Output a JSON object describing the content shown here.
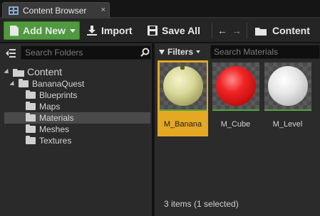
{
  "tab": {
    "title": "Content Browser",
    "close": "×"
  },
  "toolbar": {
    "add_new": "Add New",
    "import": "Import",
    "save_all": "Save All",
    "back": "←",
    "forward": "→",
    "path": "Content"
  },
  "sources": {
    "search_placeholder": "Search Folders",
    "tree": [
      {
        "label": "Content",
        "level": 0,
        "expanded": true,
        "selected": false
      },
      {
        "label": "BananaQuest",
        "level": 1,
        "expanded": true,
        "selected": false
      },
      {
        "label": "Blueprints",
        "level": 2,
        "selected": false
      },
      {
        "label": "Maps",
        "level": 2,
        "selected": false
      },
      {
        "label": "Materials",
        "level": 2,
        "selected": true
      },
      {
        "label": "Meshes",
        "level": 2,
        "selected": false
      },
      {
        "label": "Textures",
        "level": 2,
        "selected": false
      }
    ]
  },
  "assets": {
    "filters_label": "Filters",
    "search_placeholder": "Search Materials",
    "items": [
      {
        "name": "M_Banana",
        "selected": true,
        "color": "#d9d99a"
      },
      {
        "name": "M_Cube",
        "selected": false,
        "color": "#f02424"
      },
      {
        "name": "M_Level",
        "selected": false,
        "color": "#e6e6e6"
      }
    ],
    "status": "3 items (1 selected)"
  },
  "colors": {
    "accent_green": "#4f9a3e",
    "selection_orange": "#e5a823"
  }
}
